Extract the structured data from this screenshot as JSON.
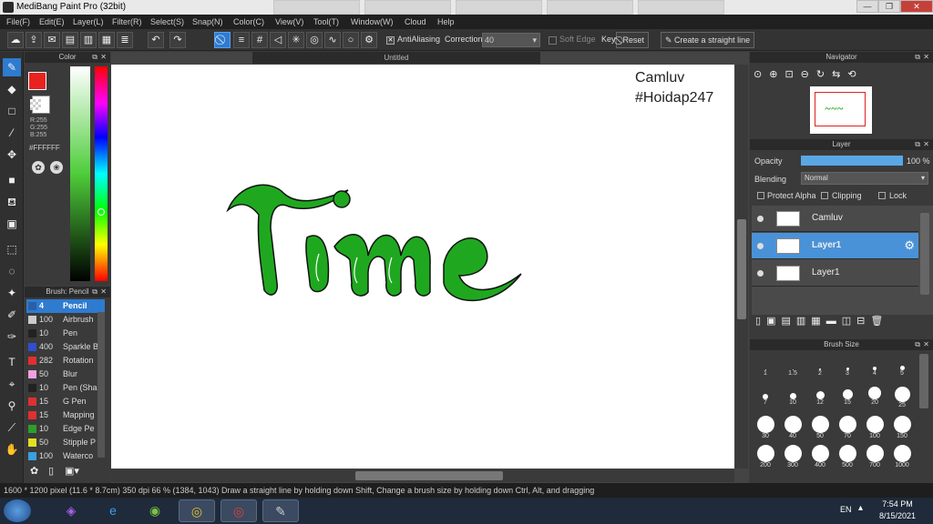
{
  "window": {
    "title": "MediBang Paint Pro (32bit)",
    "controls": {
      "minimize": "—",
      "maximize": "❐",
      "close": "✕"
    }
  },
  "menu": [
    "File(F)",
    "Edit(E)",
    "Layer(L)",
    "Filter(R)",
    "Select(S)",
    "Snap(N)",
    "Color(C)",
    "View(V)",
    "Tool(T)",
    "Window(W)",
    "Cloud",
    "Help"
  ],
  "toolbar": {
    "antialiasing_label": "AntiAliasing",
    "correction_label": "Correction",
    "correction_value": "40",
    "soft_edge_label": "Soft Edge",
    "key_label": "Key",
    "reset_label": "Reset",
    "straight_line_label": "Create a straight line"
  },
  "color_panel": {
    "title": "Color",
    "r": "R:255",
    "g": "G:255",
    "b": "B:255",
    "hex": "#FFFFFF",
    "primary_color": "#e8231f",
    "secondary_color": "#ffffff"
  },
  "brush_panel": {
    "title": "Brush: Pencil",
    "items": [
      {
        "size": "4",
        "name": "Pencil",
        "color": "#2a5fa8"
      },
      {
        "size": "100",
        "name": "Airbrush",
        "color": "#cccccc"
      },
      {
        "size": "10",
        "name": "Pen",
        "color": "#222222"
      },
      {
        "size": "400",
        "name": "Sparkle B",
        "color": "#2e4fcf"
      },
      {
        "size": "282",
        "name": "Rotation",
        "color": "#e03030"
      },
      {
        "size": "50",
        "name": "Blur",
        "color": "#f0a0e0"
      },
      {
        "size": "10",
        "name": "Pen (Sha",
        "color": "#222222"
      },
      {
        "size": "15",
        "name": "G Pen",
        "color": "#e03030"
      },
      {
        "size": "15",
        "name": "Mapping",
        "color": "#e03030"
      },
      {
        "size": "10",
        "name": "Edge Pe",
        "color": "#2aa02a"
      },
      {
        "size": "50",
        "name": "Stipple P",
        "color": "#e0e020"
      },
      {
        "size": "100",
        "name": "Waterco",
        "color": "#3aa0e0"
      }
    ]
  },
  "document": {
    "tab": "Untitled",
    "watermark_line1": "Camluv",
    "watermark_line2": "#Hoidap247"
  },
  "navigator": {
    "title": "Navigator"
  },
  "layer_panel": {
    "title": "Layer",
    "opacity_label": "Opacity",
    "opacity_value": "100 %",
    "opacity_fraction": 1.0,
    "blending_label": "Blending",
    "blending_value": "Normal",
    "protect_alpha": "Protect Alpha",
    "clipping": "Clipping",
    "lock": "Lock",
    "layers": [
      {
        "name": "Camluv"
      },
      {
        "name": "Layer1"
      },
      {
        "name": "Layer1"
      }
    ]
  },
  "brush_size_panel": {
    "title": "Brush Size",
    "sizes": [
      "",
      "1",
      "1.5",
      "2",
      "3",
      "4",
      "5",
      "7",
      "10",
      "12",
      "15",
      "20",
      "25",
      "30",
      "40",
      "50",
      "70",
      "100",
      "150",
      "200",
      "300",
      "400",
      "500",
      "700",
      "1000"
    ]
  },
  "status": {
    "text": "1600 * 1200 pixel  (11.6 * 8.7cm)  350 dpi  66 %  (1384, 1043)  Draw a straight line by holding down Shift, Change a brush size by holding down Ctrl, Alt, and dragging"
  },
  "taskbar": {
    "lang": "EN",
    "time": "7:54 PM",
    "date": "8/15/2021"
  },
  "colors": {
    "accent": "#2e7bd0",
    "letter_green": "#1fa81f"
  }
}
